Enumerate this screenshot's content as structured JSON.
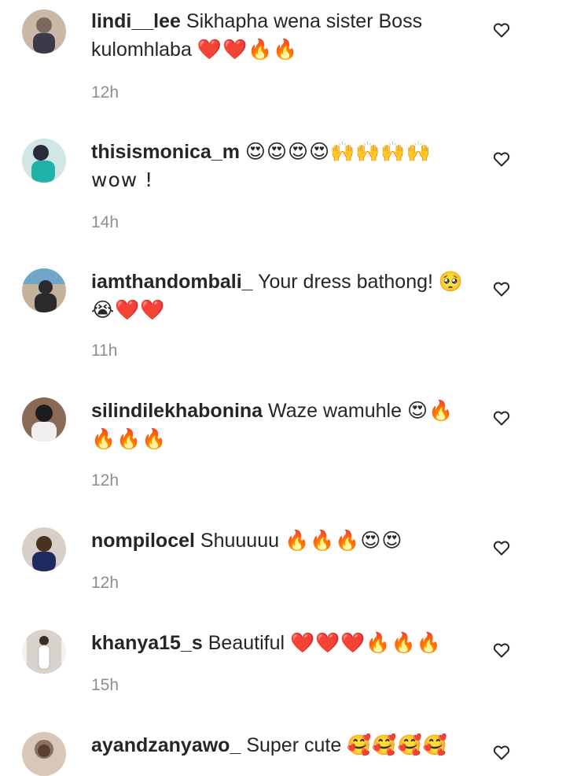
{
  "comments": [
    {
      "username": "lindi__lee",
      "text": "Sikhapha wena sister Boss kulomhlaba",
      "emoji": "❤️❤️🔥🔥",
      "time": "12h",
      "avatar_colors": [
        "#3a3a4a",
        "#7a6a60",
        "#c9b8a8"
      ]
    },
    {
      "username": "thisismonica_m",
      "text": "",
      "emoji": "😍😍😍😍🙌🙌🙌🙌wow !",
      "time": "14h",
      "avatar_colors": [
        "#2a2a3a",
        "#20b2aa",
        "#d2e6e4"
      ]
    },
    {
      "username": "iamthandombali_",
      "text": "Your dress bathong!",
      "emoji": "🥺😭❤️❤️",
      "time": "11h",
      "avatar_colors": [
        "#2b2b2b",
        "#6fa6c9",
        "#c4b39a"
      ]
    },
    {
      "username": "silindilekhabonina",
      "text": "Waze wamuhle",
      "emoji": "😍🔥🔥🔥🔥",
      "time": "12h",
      "avatar_colors": [
        "#1c1c1c",
        "#f0f0f0",
        "#8a6a55"
      ]
    },
    {
      "username": "nompilocel",
      "text": "Shuuuuu",
      "emoji": "🔥🔥🔥😍😍",
      "time": "12h",
      "avatar_colors": [
        "#4a3020",
        "#1e2a60",
        "#d8d0c8"
      ]
    },
    {
      "username": "khanya15_s",
      "text": "Beautiful",
      "emoji": "❤️❤️❤️🔥🔥🔥",
      "time": "15h",
      "avatar_colors": [
        "#d8d2cc",
        "#f5f2ee",
        "#3a2e28"
      ]
    },
    {
      "username": "ayandzanyawo_",
      "text": "Super cute",
      "emoji": "🥰🥰🥰🥰",
      "time": "",
      "avatar_colors": [
        "#8a7060",
        "#d9c8b8",
        "#5a3f30"
      ]
    }
  ],
  "colors": {
    "text": "#262626",
    "muted": "#8e8e8e",
    "background": "#ffffff"
  },
  "icons": {
    "like": "heart-outline-icon"
  }
}
